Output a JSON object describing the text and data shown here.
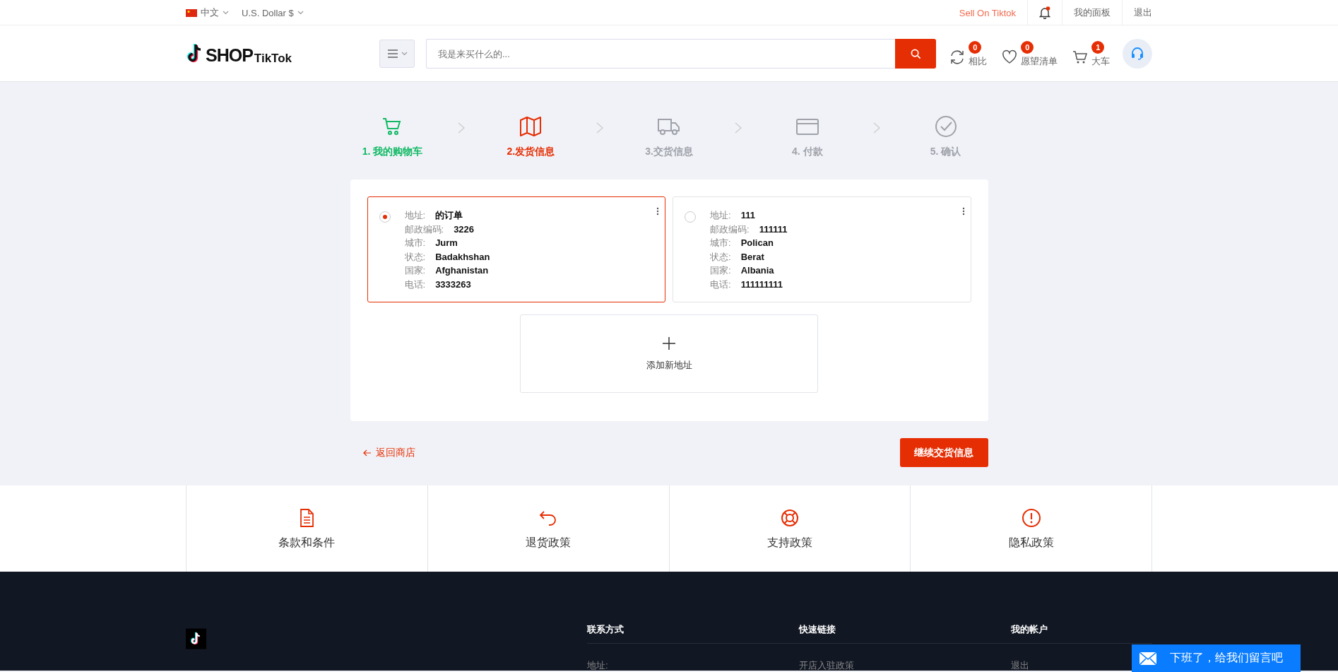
{
  "top_bar": {
    "language": "中文",
    "currency": "U.S. Dollar $",
    "sell_link": "Sell On Tiktok",
    "notification_unread": true,
    "links": [
      "我的面板",
      "退出"
    ]
  },
  "header": {
    "logo": {
      "main": "SHOP",
      "sub": "TikTok"
    },
    "search": {
      "placeholder": "我是来买什么的..."
    },
    "actions": [
      {
        "kind": "compare",
        "count": "0",
        "label": "相比"
      },
      {
        "kind": "wishlist",
        "count": "0",
        "label": "愿望清单"
      },
      {
        "kind": "cart",
        "count": "1",
        "label": "大车"
      }
    ]
  },
  "steps": [
    {
      "kind": "cart",
      "label": "1. 我的购物车",
      "completed": true,
      "selected": false
    },
    {
      "kind": "map",
      "label": "2.发货信息",
      "completed": false,
      "selected": true
    },
    {
      "kind": "truck",
      "label": "3.交货信息",
      "completed": false,
      "selected": false
    },
    {
      "kind": "card",
      "label": "4. 付款",
      "completed": false,
      "selected": false
    },
    {
      "kind": "check",
      "label": "5. 确认",
      "completed": false,
      "selected": false
    }
  ],
  "addresses": [
    {
      "selected": true,
      "fields": [
        {
          "label": "地址:",
          "value": "的订单"
        },
        {
          "label": "邮政编码:",
          "value": "3226"
        },
        {
          "label": "城市:",
          "value": "Jurm"
        },
        {
          "label": "状态:",
          "value": "Badakhshan"
        },
        {
          "label": "国家:",
          "value": "Afghanistan"
        },
        {
          "label": "电话:",
          "value": "3333263"
        }
      ]
    },
    {
      "selected": false,
      "fields": [
        {
          "label": "地址:",
          "value": "111"
        },
        {
          "label": "邮政编码:",
          "value": "111111"
        },
        {
          "label": "城市:",
          "value": "Polican"
        },
        {
          "label": "状态:",
          "value": "Berat"
        },
        {
          "label": "国家:",
          "value": "Albania"
        },
        {
          "label": "电话:",
          "value": "111111111"
        }
      ]
    }
  ],
  "add_address": "添加新地址",
  "back_link": "返回商店",
  "continue_button": "继续交货信息",
  "policies": [
    {
      "kind": "document",
      "label": "条款和条件"
    },
    {
      "kind": "return",
      "label": "退货政策"
    },
    {
      "kind": "support",
      "label": "支持政策"
    },
    {
      "kind": "alert",
      "label": "隐私政策"
    }
  ],
  "footer": {
    "columns": [
      {
        "heading": "联系方式",
        "items": [
          "地址:"
        ]
      },
      {
        "heading": "快速链接",
        "items": [
          "开店入驻政策"
        ]
      },
      {
        "heading": "我的帐户",
        "items": [
          "退出"
        ]
      }
    ]
  },
  "chat_widget": "下班了，给我们留言吧"
}
